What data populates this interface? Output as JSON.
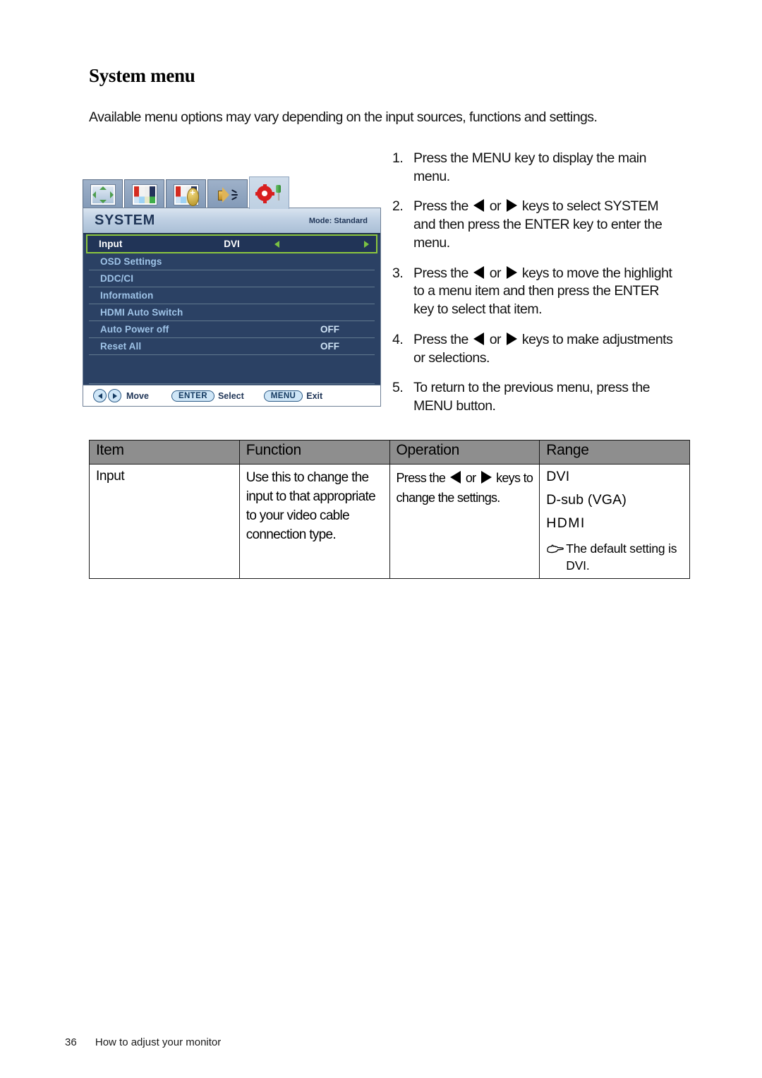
{
  "page": {
    "title": "System menu",
    "intro": "Available menu options may vary depending on the input sources, functions and settings.",
    "footer_page_number": "36",
    "footer_text": "How to adjust your monitor"
  },
  "osd": {
    "tabs": [
      {
        "name": "display-tab",
        "icon": "move-arrows-icon"
      },
      {
        "name": "picture-tab",
        "icon": "color-bars-icon"
      },
      {
        "name": "picture-advanced-tab",
        "icon": "color-bars-plus-icon"
      },
      {
        "name": "audio-tab",
        "icon": "speaker-icon"
      },
      {
        "name": "system-tab",
        "icon": "gear-screwdriver-icon",
        "active": true
      }
    ],
    "header_title": "SYSTEM",
    "mode_label": "Mode: Standard",
    "items": [
      {
        "label": "Input",
        "value": "DVI",
        "highlighted": true
      },
      {
        "label": "OSD Settings",
        "value": ""
      },
      {
        "label": "DDC/CI",
        "value": ""
      },
      {
        "label": "Information",
        "value": ""
      },
      {
        "label": "HDMI Auto Switch",
        "value": ""
      },
      {
        "label": "Auto Power off",
        "value": "OFF"
      },
      {
        "label": "Reset All",
        "value": "OFF"
      }
    ],
    "footer": {
      "move_label": "Move",
      "enter_label": "ENTER",
      "select_label": "Select",
      "menu_label": "MENU",
      "exit_label": "Exit"
    },
    "colors": {
      "highlight_border": "#8cc63e",
      "panel_bg": "#2b4164",
      "header_bg": "#bfd0e3",
      "item_text": "#9fc4e8"
    }
  },
  "steps": [
    {
      "num": "1.",
      "part1": "Press the MENU key to display the main menu.",
      "part2": "",
      "has_arrows": false
    },
    {
      "num": "2.",
      "part1": "Press the ",
      "part2": " keys to select SYSTEM and then press the ENTER key to enter the menu.",
      "has_arrows": true,
      "between": " or "
    },
    {
      "num": "3.",
      "part1": "Press the ",
      "part2": " keys to move the highlight to a menu item and then press the ENTER key to select that item.",
      "has_arrows": true,
      "between": " or "
    },
    {
      "num": "4.",
      "part1": "Press the ",
      "part2": " keys to make adjustments or selections.",
      "has_arrows": true,
      "between": " or "
    },
    {
      "num": "5.",
      "part1": "To return to the previous menu, press the MENU button.",
      "part2": "",
      "has_arrows": false
    }
  ],
  "table": {
    "headers": [
      "Item",
      "Function",
      "Operation",
      "Range"
    ],
    "row": {
      "item": "Input",
      "function": "Use this to change the input to that appropriate to your video cable connection type.",
      "operation_before": "Press the ",
      "operation_between": " or ",
      "operation_after": " keys to change the settings.",
      "range": [
        "DVI",
        "D-sub (VGA)",
        "HDMI"
      ],
      "note": "The default setting is DVI.",
      "note_icon": "pointing-hand-icon"
    }
  }
}
